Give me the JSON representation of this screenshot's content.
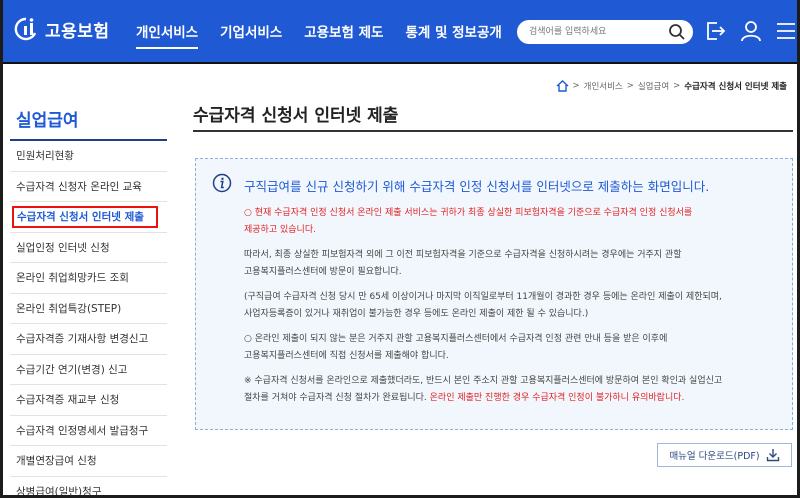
{
  "header": {
    "logo_text": "고용보험",
    "nav": [
      "개인서비스",
      "기업서비스",
      "고용보험 제도",
      "통계 및 정보공개"
    ],
    "search_placeholder": "검색어를 입력하세요",
    "brand_color": "#1f5ad4"
  },
  "breadcrumb": {
    "items": [
      "개인서비스",
      "실업급여"
    ],
    "current": "수급자격 신청서 인터넷 제출"
  },
  "sidebar": {
    "title": "실업급여",
    "items": [
      "민원처리현황",
      "수급자격 신청자 온라인 교육",
      "수급자격 신청서 인터넷 제출",
      "실업인정 인터넷 신청",
      "온라인 취업희망카드 조회",
      "온라인 취업특강(STEP)",
      "수급자격증 기재사항 변경신고",
      "수급기간 연기(변경) 신고",
      "수급자격증 재교부 신청",
      "수급자격 인정명세서 발급청구",
      "개별연장급여 신청",
      "상병급여(일반)청구"
    ]
  },
  "main": {
    "title": "수급자격 신청서 인터넷 제출",
    "lead": "구직급여를 신규 신청하기 위해 수급자격 인정 신청서를 인터넷으로 제출하는 화면입니다.",
    "p1_red": "○ 현재 수급자격 인정 신청서 온라인 제출 서비스는 귀하가 최종 상실한 피보험자격을 기준으로 수급자격 인정 신청서를",
    "p1_red2": "제공하고 있습니다.",
    "p2_line1": "따라서, 최종 상실한 피보험자격 외에 그 이전 피보험자격을 기준으로 수급자격을 신청하시려는 경우에는 거주지 관할",
    "p2_line2": "고용복지플러스센터에 방문이 필요합니다.",
    "p3_line1": "(구직급여 수급자격 신청 당시 만 65세 이상이거나 마지막 이직일로부터 11개월이 경과한 경우 등에는 온라인 제출이 제한되며,",
    "p3_line2": "사업자등록증이 있거나 재취업이 불가능한 경우 등에도 온라인 제출이 제한 될 수 있습니다.)",
    "p4_line1": "○ 온라인 제출이 되지 않는 분은 거주지 관할 고용복지플러스센터에서 수급자격 인정 관련 안내 등을 받은 이후에",
    "p4_line2": "고용복지플러스센터에 직접 신청서를 제출해야 합니다.",
    "p5_line1": "※ 수급자격 신청서를 온라인으로 제출했더라도, 반드시 본인 주소지 관할 고용복지플러스센터에 방문하여 본인 확인과 실업신고",
    "p5_line2_plain": "절차를 거쳐야 수급자격 신청 절차가 완료됩니다. ",
    "p5_line2_red": "온라인 제출만 진행한 경우 수급자격 인정이 불가하니 유의바랍니다.",
    "download_label": "매뉴얼 다운로드(PDF)"
  }
}
